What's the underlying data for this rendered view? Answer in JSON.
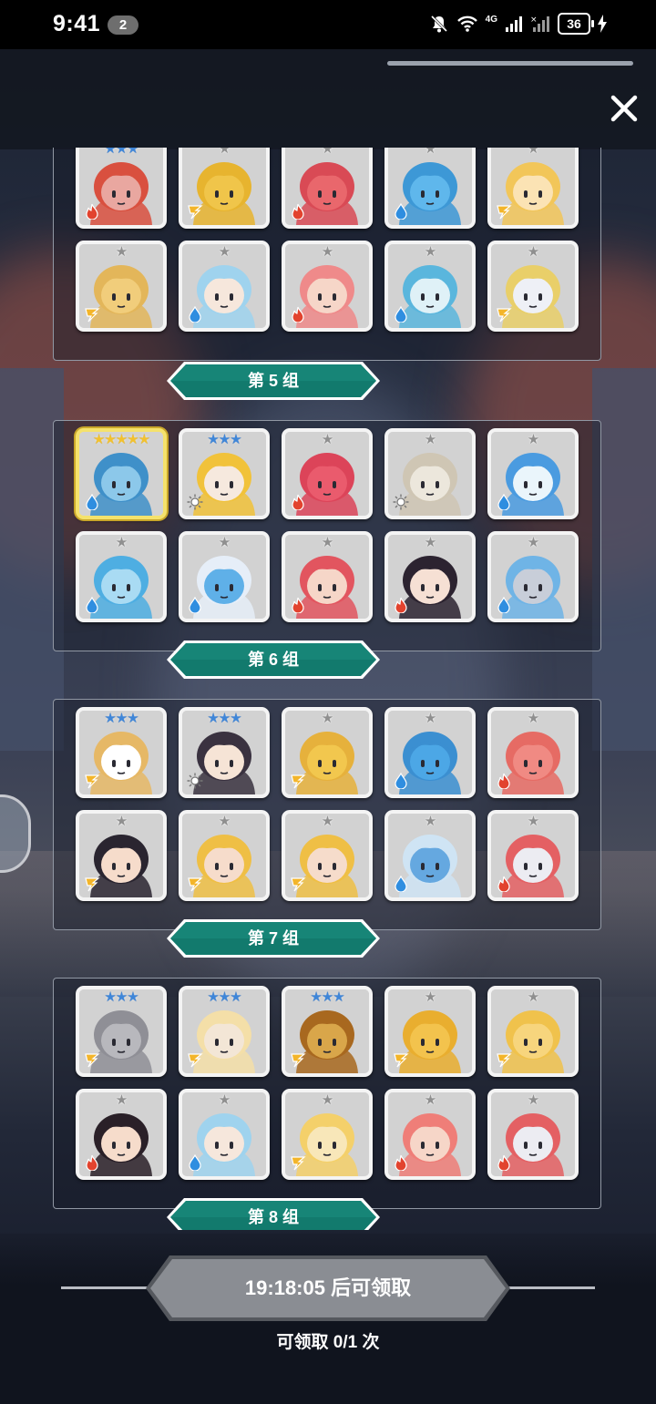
{
  "status_bar": {
    "time": "9:41",
    "notification_count": "2",
    "network": "4G",
    "battery": "36"
  },
  "groups": [
    {
      "label": "第 5 组",
      "heroes": [
        {
          "stars": 3,
          "star_color": "blue",
          "element": "fire",
          "body": "#e9a7a0",
          "hair": "#d9503f"
        },
        {
          "stars": 1,
          "star_color": "gray",
          "element": "thunder",
          "body": "#f0c54a",
          "hair": "#e7b42f"
        },
        {
          "stars": 1,
          "star_color": "gray",
          "element": "fire",
          "body": "#e9676c",
          "hair": "#d94a55"
        },
        {
          "stars": 1,
          "star_color": "gray",
          "element": "water",
          "body": "#5fb7ec",
          "hair": "#3d98d6"
        },
        {
          "stars": 1,
          "star_color": "gray",
          "element": "thunder",
          "body": "#fbe3b4",
          "hair": "#f2c659"
        },
        {
          "stars": 1,
          "star_color": "gray",
          "element": "thunder",
          "body": "#f1cd7b",
          "hair": "#e3b65a"
        },
        {
          "stars": 1,
          "star_color": "gray",
          "element": "water",
          "body": "#f6e7dc",
          "hair": "#9fd3ee"
        },
        {
          "stars": 1,
          "star_color": "gray",
          "element": "fire",
          "body": "#f6d6c8",
          "hair": "#ef8a8a"
        },
        {
          "stars": 1,
          "star_color": "gray",
          "element": "water",
          "body": "#dff1f7",
          "hair": "#5ab6dd"
        },
        {
          "stars": 1,
          "star_color": "gray",
          "element": "thunder",
          "body": "#eef0f6",
          "hair": "#e9cf69"
        }
      ]
    },
    {
      "label": "第 6 组",
      "heroes": [
        {
          "stars": 5,
          "star_color": "gold",
          "element": "water",
          "body": "#8cc8ea",
          "hair": "#3f90c9",
          "legend": true
        },
        {
          "stars": 3,
          "star_color": "blue",
          "element": "light",
          "body": "#f6e9de",
          "hair": "#f1c23a"
        },
        {
          "stars": 1,
          "star_color": "gray",
          "element": "fire",
          "body": "#ea5b6d",
          "hair": "#dc4459"
        },
        {
          "stars": 1,
          "star_color": "gray",
          "element": "light",
          "body": "#ece7dc",
          "hair": "#cfc6b4"
        },
        {
          "stars": 1,
          "star_color": "gray",
          "element": "water",
          "body": "#eaf5fb",
          "hair": "#4a9be0"
        },
        {
          "stars": 1,
          "star_color": "gray",
          "element": "water",
          "body": "#a9dbf3",
          "hair": "#4eaee2"
        },
        {
          "stars": 1,
          "star_color": "gray",
          "element": "water",
          "body": "#5fb0e8",
          "hair": "#e6eef8"
        },
        {
          "stars": 1,
          "star_color": "gray",
          "element": "fire",
          "body": "#f6d6c8",
          "hair": "#e2555f"
        },
        {
          "stars": 1,
          "star_color": "gray",
          "element": "fire",
          "body": "#f6e0d4",
          "hair": "#2c2330"
        },
        {
          "stars": 1,
          "star_color": "gray",
          "element": "water",
          "body": "#c8ced9",
          "hair": "#6fb4e6"
        }
      ]
    },
    {
      "label": "第 7 组",
      "heroes": [
        {
          "stars": 3,
          "star_color": "blue",
          "element": "thunder",
          "body": "#ffffff",
          "hair": "#e6b866"
        },
        {
          "stars": 3,
          "star_color": "blue",
          "element": "light",
          "body": "#f6e4d6",
          "hair": "#3a3240"
        },
        {
          "stars": 1,
          "star_color": "gray",
          "element": "thunder",
          "body": "#f2c74e",
          "hair": "#e6b13c"
        },
        {
          "stars": 1,
          "star_color": "gray",
          "element": "water",
          "body": "#4ca7e6",
          "hair": "#3b8fd1"
        },
        {
          "stars": 1,
          "star_color": "gray",
          "element": "fire",
          "body": "#f08a83",
          "hair": "#e66b64"
        },
        {
          "stars": 1,
          "star_color": "gray",
          "element": "thunder",
          "body": "#f6dccb",
          "hair": "#2a2530"
        },
        {
          "stars": 1,
          "star_color": "gray",
          "element": "thunder",
          "body": "#f6dccb",
          "hair": "#efbf45"
        },
        {
          "stars": 1,
          "star_color": "gray",
          "element": "thunder",
          "body": "#f6dccb",
          "hair": "#efbf45"
        },
        {
          "stars": 1,
          "star_color": "gray",
          "element": "water",
          "body": "#65a8e0",
          "hair": "#cfe4f4"
        },
        {
          "stars": 1,
          "star_color": "gray",
          "element": "fire",
          "body": "#ececf2",
          "hair": "#e46063"
        }
      ]
    },
    {
      "label": "第 8 组",
      "heroes": [
        {
          "stars": 3,
          "star_color": "blue",
          "element": "thunder",
          "body": "#b8b8bd",
          "hair": "#8f8f96"
        },
        {
          "stars": 3,
          "star_color": "blue",
          "element": "thunder",
          "body": "#f3e6d6",
          "hair": "#f4dfa8"
        },
        {
          "stars": 3,
          "star_color": "blue",
          "element": "thunder",
          "body": "#d9a64a",
          "hair": "#a8681f"
        },
        {
          "stars": 1,
          "star_color": "gray",
          "element": "thunder",
          "body": "#f3c34d",
          "hair": "#e9ae2f"
        },
        {
          "stars": 1,
          "star_color": "gray",
          "element": "thunder",
          "body": "#f7d57d",
          "hair": "#f0c24c"
        },
        {
          "stars": 1,
          "star_color": "gray",
          "element": "fire",
          "body": "#f6dccb",
          "hair": "#2a2028"
        },
        {
          "stars": 1,
          "star_color": "gray",
          "element": "water",
          "body": "#f6e7dc",
          "hair": "#9fd3ee"
        },
        {
          "stars": 1,
          "star_color": "gray",
          "element": "thunder",
          "body": "#f8e7b9",
          "hair": "#f4d06a"
        },
        {
          "stars": 1,
          "star_color": "gray",
          "element": "fire",
          "body": "#f6d6c8",
          "hair": "#ef7e78"
        },
        {
          "stars": 1,
          "star_color": "gray",
          "element": "fire",
          "body": "#ececf2",
          "hair": "#e46063"
        }
      ]
    }
  ],
  "claim": {
    "button_label": "19:18:05 后可领取",
    "count_text": "可领取 0/1 次"
  },
  "colors": {
    "label_teal": "#127a6d",
    "label_border": "#ffffff",
    "claim_button": "#8a8d93"
  },
  "icons": {
    "close": "close-icon",
    "element_fire": "fire-element-icon",
    "element_water": "water-element-icon",
    "element_thunder": "thunder-element-icon",
    "element_light": "light-element-icon"
  }
}
